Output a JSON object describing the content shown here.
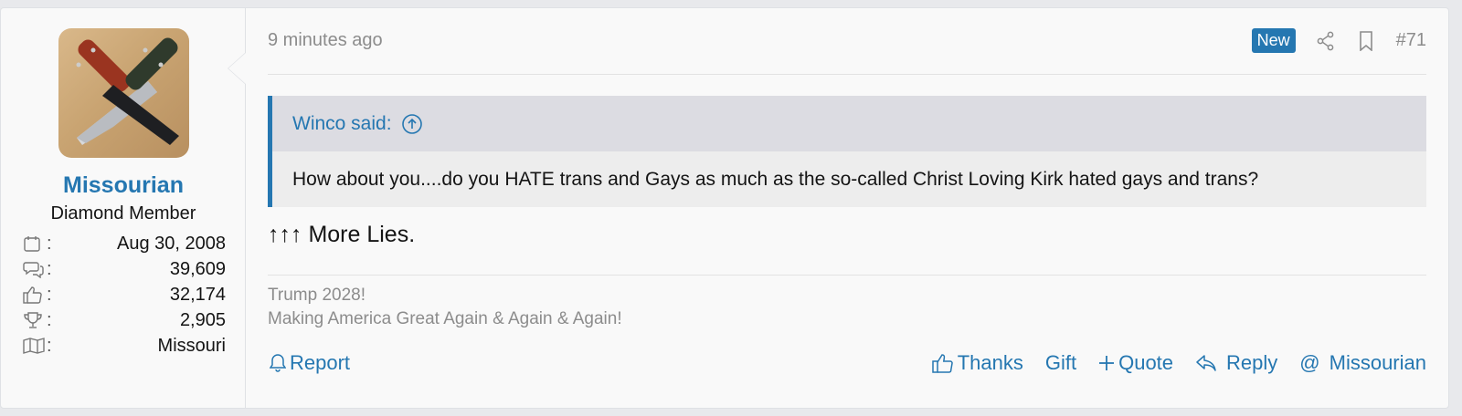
{
  "user": {
    "name": "Missourian",
    "title": "Diamond Member",
    "stats": [
      {
        "icon": "calendar-icon",
        "value": "Aug 30, 2008"
      },
      {
        "icon": "messages-icon",
        "value": "39,609"
      },
      {
        "icon": "thumbs-up-icon",
        "value": "32,174"
      },
      {
        "icon": "trophy-icon",
        "value": "2,905"
      },
      {
        "icon": "map-icon",
        "value": "Missouri"
      }
    ]
  },
  "post": {
    "time": "9 minutes ago",
    "badge": "New",
    "number": "#71",
    "quote": {
      "author": "Winco said:",
      "text": "How about you....do you HATE trans and Gays as much as the so-called Christ Loving Kirk hated gays and trans?"
    },
    "message": "↑↑↑ More Lies.",
    "signature": [
      "Trump 2028!",
      "Making America Great Again & Again & Again!"
    ]
  },
  "actions": {
    "report": "Report",
    "thanks": "Thanks",
    "gift": "Gift",
    "quote": "Quote",
    "reply": "Reply",
    "mention": "Missourian"
  },
  "colors": {
    "accent": "#2577b1",
    "muted": "#8c8c8c",
    "quote_bg": "#ededed",
    "quote_head_bg": "#dcdce2"
  }
}
